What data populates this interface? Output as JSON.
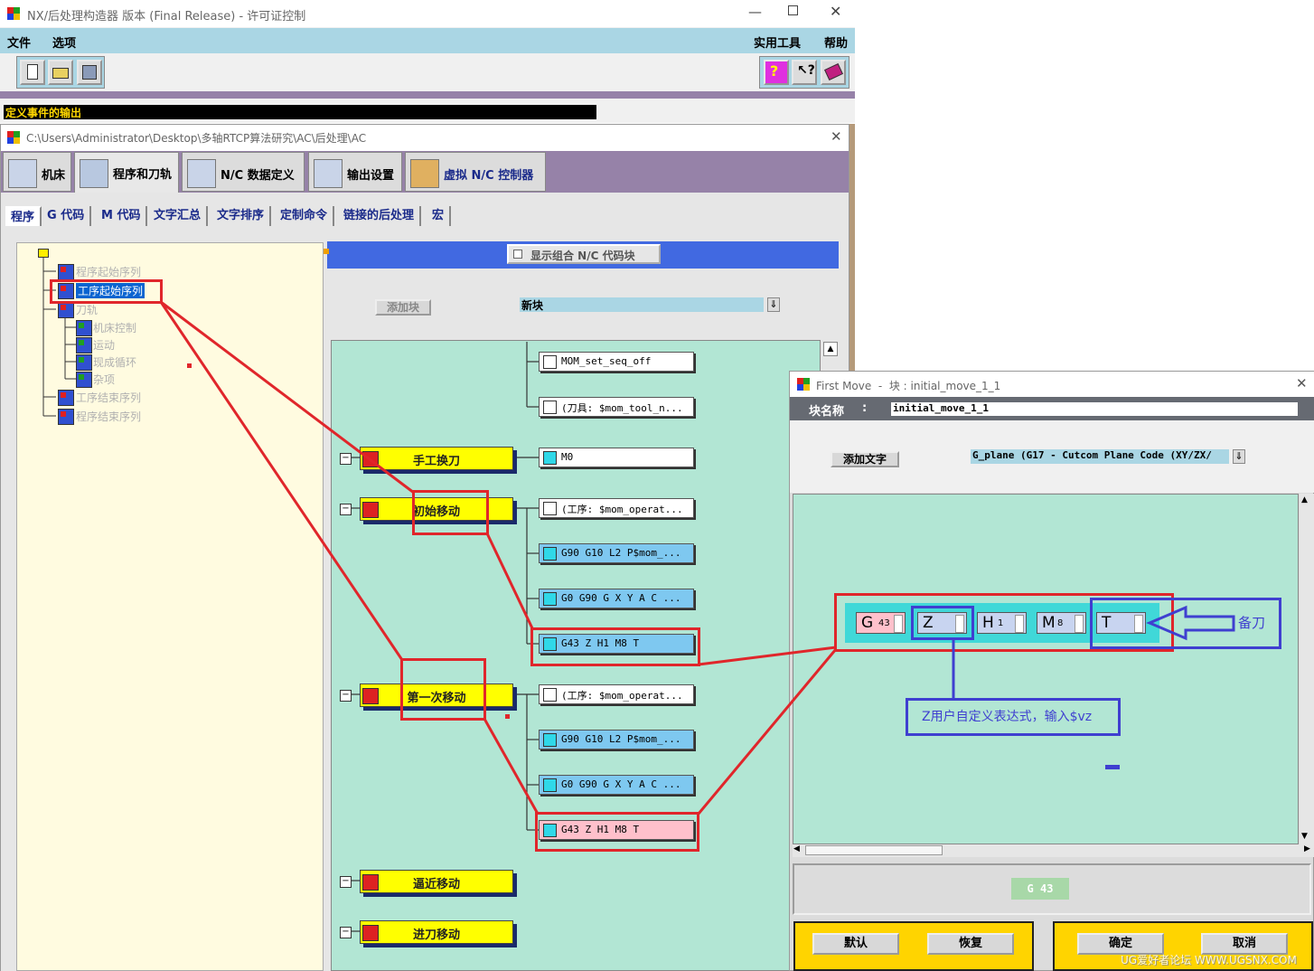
{
  "main_window": {
    "title": "NX/后处理构造器 版本 (Final Release) - 许可证控制",
    "menu": {
      "file": "文件",
      "options": "选项",
      "utilities": "实用工具",
      "help": "帮助"
    },
    "status_bar": "定义事件的输出"
  },
  "project_window": {
    "title": "C:\\Users\\Administrator\\Desktop\\多轴RTCP算法研究\\AC\\后处理\\AC",
    "main_tabs": [
      "机床",
      "程序和刀轨",
      "N/C 数据定义",
      "输出设置",
      "虚拟 N/C 控制器"
    ],
    "sub_tabs": [
      "程序",
      "G 代码",
      "M 代码",
      "文字汇总",
      "文字排序",
      "定制命令",
      "链接的后处理",
      "宏"
    ],
    "tree": {
      "program_start": "程序起始序列",
      "operation_start": "工序起始序列",
      "tool_path": "刀轨",
      "machine_control": "机床控制",
      "motion": "运动",
      "canned_cycle": "现成循环",
      "misc": "杂项",
      "operation_end": "工序结束序列",
      "program_end": "程序结束序列"
    },
    "show_combined_label": "显示组合 N/C 代码块",
    "add_block_label": "添加块",
    "new_block_value": "新块",
    "events": [
      "手工换刀",
      "初始移动",
      "第一次移动",
      "逼近移动",
      "进刀移动"
    ],
    "blocks": {
      "seq_off": "MOM_set_seq_off",
      "tool_comment": "(刀具: $mom_tool_n...",
      "m0": "M0",
      "init_op": "(工序: $mom_operat...",
      "init_g90": "G90 G10 L2 P$mom_...",
      "init_g0": "G0 G90 G X Y A C ...",
      "init_g43": "G43 Z H1 M8 T",
      "first_op": "(工序: $mom_operat...",
      "first_g90": "G90 G10 L2 P$mom_...",
      "first_g0": "G0 G90 G X Y A C ...",
      "first_g43": "G43 Z H1 M8 T"
    }
  },
  "first_move_dialog": {
    "title": "First Move  -  块 : initial_move_1_1",
    "block_name_label": "块名称",
    "block_name_colon": ":",
    "block_name_value": "initial_move_1_1",
    "add_word_label": "添加文字",
    "word_select_value": "G_plane (G17 - Cutcom Plane Code (XY/ZX/",
    "words": [
      {
        "letter": "G",
        "sub": "43"
      },
      {
        "letter": "Z",
        "sub": ""
      },
      {
        "letter": "H",
        "sub": "1"
      },
      {
        "letter": "M",
        "sub": "8"
      },
      {
        "letter": "T",
        "sub": ""
      }
    ],
    "preview_code": "G 43",
    "buttons": {
      "default": "默认",
      "restore": "恢复",
      "ok": "确定",
      "cancel": "取消"
    }
  },
  "annotations": {
    "spare_tool": "备刀",
    "z_note": "Z用户自定义表达式，输入$vz"
  },
  "watermark": "UG爱好者论坛 WWW.UGSNX.COM",
  "colors": {
    "menu_bar": "#aad6e4",
    "tab_band": "#9682a8",
    "editor_bg": "#b2e6d4",
    "event_yellow": "#ffff00",
    "block_blue": "#7ec8f0",
    "block_pink": "#ffc0cb",
    "annotation_red": "#e0262b",
    "annotation_blue": "#3f3fd0"
  }
}
